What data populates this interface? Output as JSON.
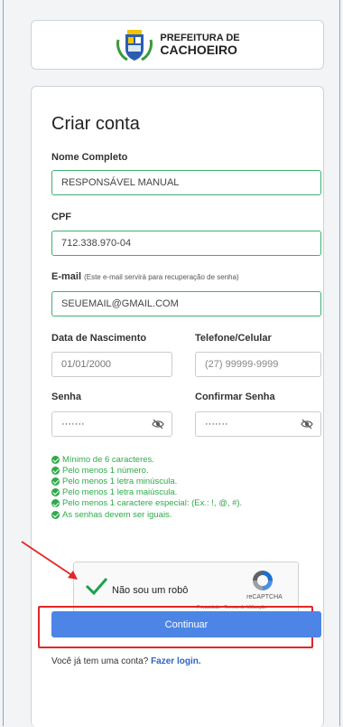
{
  "header": {
    "logo_line1": "PREFEITURA DE",
    "logo_line2": "CACHOEIRO"
  },
  "form": {
    "title": "Criar conta",
    "full_name": {
      "label": "Nome Completo",
      "value": "RESPONSÁVEL MANUAL"
    },
    "cpf": {
      "label": "CPF",
      "value": "712.338.970-04"
    },
    "email": {
      "label": "E-mail",
      "hint": "(Este e-mail servirá para recuperação de senha)",
      "value": "SEUEMAIL@GMAIL.COM"
    },
    "birth": {
      "label": "Data de Nascimento",
      "value": "01/01/2000"
    },
    "phone": {
      "label": "Telefone/Celular",
      "placeholder": "(27) 99999-9999"
    },
    "password": {
      "label": "Senha",
      "value": "·······"
    },
    "confirm": {
      "label": "Confirmar Senha",
      "value": "·······"
    },
    "rules": [
      "Mínimo de 6 caracteres.",
      "Pelo menos 1 número.",
      "Pelo menos 1 letra minúscula.",
      "Pelo menos 1 letra maiúscula.",
      "Pelo menos 1 caractere especial: (Ex.: !, @, #).",
      "As senhas devem ser iguais."
    ],
    "captcha": {
      "text": "Não sou um robô",
      "brand": "reCAPTCHA",
      "terms": "Privacidade - Termos de Utilização"
    },
    "submit": "Continuar",
    "login_prompt": "Você já tem uma conta?",
    "login_link": "Fazer login."
  },
  "colors": {
    "accent": "#4c85e6",
    "valid": "#2eaa4a",
    "highlight": "#e32626"
  }
}
